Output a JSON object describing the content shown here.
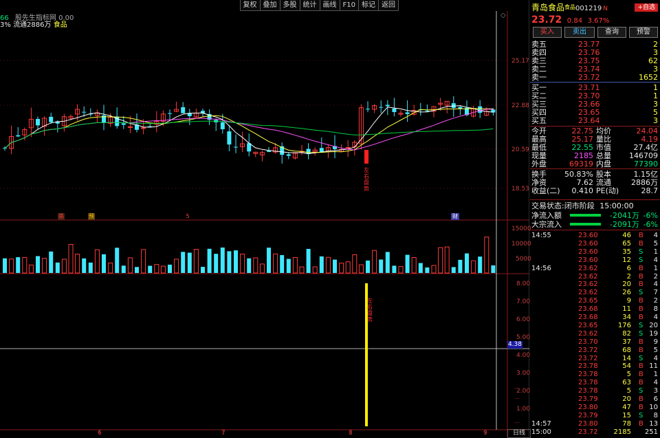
{
  "toolbar": [
    "复权",
    "叠加",
    "多股",
    "统计",
    "画线",
    "F10",
    "标记",
    "+自选",
    "返回"
  ],
  "info": {
    "line1_value": "66",
    "line1_text": "股先生指标网",
    "line1_num": "0.00",
    "line2_pct": "3%",
    "line2_text": "流通2886万",
    "line2_name": "食品"
  },
  "price_axis": [
    "25.17",
    "22.88",
    "20.59",
    "18.53"
  ],
  "volume_axis": [
    "15000",
    "10000",
    "5000"
  ],
  "indicator_axis": [
    "8.00",
    "7.00",
    "6.00",
    "5.00",
    "4.00",
    "3.00",
    "2.00",
    "1.00"
  ],
  "indicator_marker": "4.38",
  "annotation": "左右盘势",
  "event_tags": [
    "杀",
    "预",
    "5",
    "财"
  ],
  "date_labels": [
    "6",
    "7",
    "8",
    "9"
  ],
  "period_label": "日线",
  "stock": {
    "name": "青岛食品",
    "tag": "食品",
    "code": "001219",
    "flag": "N",
    "add_button": "+自选",
    "price": "23.72",
    "change": "0.84",
    "change_pct": "3.67%"
  },
  "actions": [
    "买入",
    "卖出",
    "查询",
    "预警"
  ],
  "order_book": {
    "asks": [
      {
        "label": "卖五",
        "price": "23.77",
        "vol": "2"
      },
      {
        "label": "卖四",
        "price": "23.76",
        "vol": "3"
      },
      {
        "label": "卖三",
        "price": "23.75",
        "vol": "62"
      },
      {
        "label": "卖二",
        "price": "23.74",
        "vol": "3"
      },
      {
        "label": "卖一",
        "price": "23.72",
        "vol": "1652"
      }
    ],
    "bids": [
      {
        "label": "买一",
        "price": "23.71",
        "vol": "1"
      },
      {
        "label": "买二",
        "price": "23.70",
        "vol": "1"
      },
      {
        "label": "买三",
        "price": "23.66",
        "vol": "3"
      },
      {
        "label": "买四",
        "price": "23.65",
        "vol": "5"
      },
      {
        "label": "买五",
        "price": "23.64",
        "vol": "3"
      }
    ]
  },
  "stats": [
    {
      "l1": "今开",
      "v1": "22.75",
      "l2": "均价",
      "v2": "24.04"
    },
    {
      "l1": "最高",
      "v1": "25.17",
      "l2": "量比",
      "v2": "4.19"
    },
    {
      "l1": "最低",
      "v1": "22.55",
      "l2": "市值",
      "v2": "27.4亿"
    },
    {
      "l1": "现量",
      "v1": "2185",
      "l2": "总量",
      "v2": "146709"
    },
    {
      "l1": "外盘",
      "v1": "69319",
      "l2": "内盘",
      "v2": "77390"
    },
    {
      "l1": "换手",
      "v1": "50.83%",
      "l2": "股本",
      "v2": "1.15亿"
    },
    {
      "l1": "净资",
      "v1": "7.62",
      "l2": "流通",
      "v2": "2886万"
    },
    {
      "l1": "收益(二)",
      "v1": "0.410",
      "l2": "PE(动)",
      "v2": "28.7"
    }
  ],
  "trade_status": {
    "label": "交易状态:",
    "value": "闭市阶段",
    "time": "15:00:00"
  },
  "flows": [
    {
      "label": "净流入额",
      "value": "-2041万",
      "pct": "-6%",
      "bar": 0.6
    },
    {
      "label": "大宗流入",
      "value": "-2091万",
      "pct": "-6%",
      "bar": 0.6
    }
  ],
  "ticks": [
    {
      "time": "14:55",
      "price": "23.60",
      "vol": "46",
      "side": "B",
      "n": "4"
    },
    {
      "time": "",
      "price": "23.60",
      "vol": "65",
      "side": "B",
      "n": "5"
    },
    {
      "time": "",
      "price": "23.60",
      "vol": "35",
      "side": "S",
      "n": "1"
    },
    {
      "time": "",
      "price": "23.60",
      "vol": "12",
      "side": "S",
      "n": "4"
    },
    {
      "time": "14:56",
      "price": "23.62",
      "vol": "6",
      "side": "B",
      "n": "1"
    },
    {
      "time": "",
      "price": "23.62",
      "vol": "2",
      "side": "B",
      "n": "2"
    },
    {
      "time": "",
      "price": "23.62",
      "vol": "20",
      "side": "B",
      "n": "4"
    },
    {
      "time": "",
      "price": "23.62",
      "vol": "26",
      "side": "S",
      "n": "7"
    },
    {
      "time": "",
      "price": "23.65",
      "vol": "9",
      "side": "B",
      "n": "2"
    },
    {
      "time": "",
      "price": "23.68",
      "vol": "11",
      "side": "B",
      "n": "8"
    },
    {
      "time": "",
      "price": "23.68",
      "vol": "34",
      "side": "B",
      "n": "4"
    },
    {
      "time": "",
      "price": "23.65",
      "vol": "176",
      "side": "S",
      "n": "20"
    },
    {
      "time": "",
      "price": "23.62",
      "vol": "82",
      "side": "S",
      "n": "19"
    },
    {
      "time": "",
      "price": "23.70",
      "vol": "37",
      "side": "B",
      "n": "9"
    },
    {
      "time": "",
      "price": "23.72",
      "vol": "68",
      "side": "B",
      "n": "5"
    },
    {
      "time": "",
      "price": "23.72",
      "vol": "14",
      "side": "S",
      "n": "4"
    },
    {
      "time": "",
      "price": "23.78",
      "vol": "54",
      "side": "B",
      "n": "11"
    },
    {
      "time": "",
      "price": "23.78",
      "vol": "5",
      "side": "B",
      "n": "1"
    },
    {
      "time": "",
      "price": "23.78",
      "vol": "63",
      "side": "B",
      "n": "4"
    },
    {
      "time": "",
      "price": "23.78",
      "vol": "5",
      "side": "S",
      "n": "3"
    },
    {
      "time": "",
      "price": "23.79",
      "vol": "20",
      "side": "B",
      "n": "6"
    },
    {
      "time": "",
      "price": "23.80",
      "vol": "47",
      "side": "B",
      "n": "10"
    },
    {
      "time": "",
      "price": "23.79",
      "vol": "15",
      "side": "S",
      "n": "8"
    },
    {
      "time": "14:57",
      "price": "23.80",
      "vol": "78",
      "side": "B",
      "n": "13"
    },
    {
      "time": "15:00",
      "price": "23.72",
      "vol": "2185",
      "side": "",
      "n": "251"
    }
  ],
  "colors": {
    "up": "#ff3b3b",
    "down": "#40e8ff",
    "ma5": "#ffffff",
    "ma10": "#ffff40",
    "ma20": "#ff50ff",
    "ma60": "#00d040",
    "grid": "#8b1a1a"
  }
}
